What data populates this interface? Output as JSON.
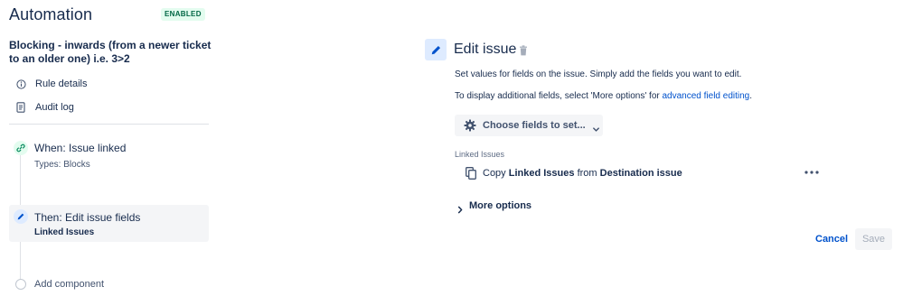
{
  "app": {
    "title": "Automation",
    "status_badge": "ENABLED"
  },
  "rule": {
    "name": "Blocking - inwards (from a newer ticket to an older one) i.e. 3>2"
  },
  "nav": {
    "rule_details": "Rule details",
    "audit_log": "Audit log"
  },
  "steps": {
    "trigger": {
      "title": "When: Issue linked",
      "subtitle": "Types: Blocks",
      "icon": "link-icon"
    },
    "action": {
      "title": "Then: Edit issue fields",
      "subtitle": "Linked Issues",
      "icon": "pencil-icon",
      "selected": true
    },
    "add": {
      "title": "Add component"
    }
  },
  "panel": {
    "title": "Edit issue",
    "description": "Set values for fields on the issue. Simply add the fields you want to edit.",
    "advanced_prefix": "To display additional fields, select 'More options' for ",
    "advanced_link": "advanced field editing",
    "advanced_suffix": ".",
    "choose_fields_label": "Choose fields to set...",
    "field_label": "Linked Issues",
    "copy": {
      "word_copy": "Copy",
      "field": "Linked Issues",
      "word_from": "from",
      "source": "Destination issue"
    },
    "more_options": "More options",
    "cancel": "Cancel",
    "save": "Save",
    "save_enabled": false
  },
  "colors": {
    "text": "#172b4d",
    "link": "#0052cc",
    "badge_bg": "#e3fcef",
    "badge_text": "#006644",
    "selected_bg": "#f4f5f7",
    "icon_blue_bg": "#deebff"
  }
}
